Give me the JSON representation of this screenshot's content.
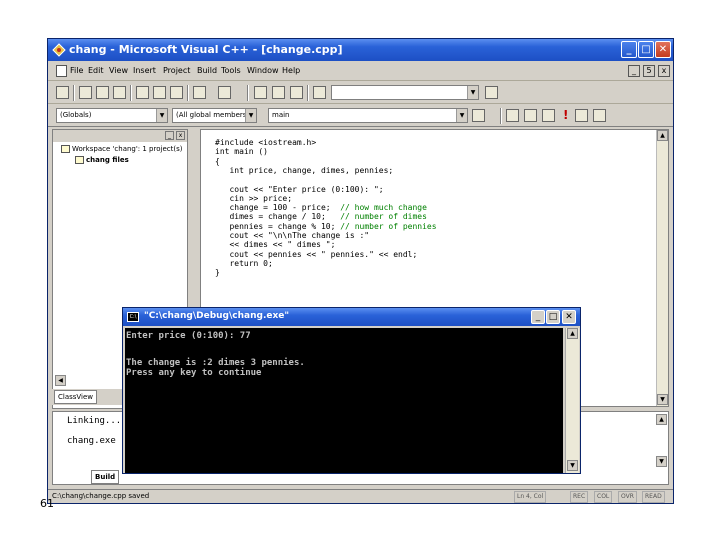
{
  "page_number": "61",
  "ide": {
    "title": "chang - Microsoft Visual C++ - [change.cpp]",
    "menu": [
      "File",
      "Edit",
      "View",
      "Insert",
      "Project",
      "Build",
      "Tools",
      "Window",
      "Help"
    ],
    "mdi_controls": [
      "_",
      "5",
      "x"
    ],
    "caption_controls": [
      "_",
      "□",
      "✕"
    ],
    "toolbar2": {
      "class_combo": "(Globals)",
      "members_combo": "(All global members)",
      "function_combo": "main"
    }
  },
  "workspace": {
    "header_buttons": [
      "x"
    ],
    "tree": [
      "Workspace 'chang': 1 project(s)",
      "chang files"
    ],
    "tabs": [
      "ClassView"
    ]
  },
  "editor": {
    "lines": [
      {
        "text": "#include <iostream.h>",
        "kind": "normal"
      },
      {
        "text": "int main ()",
        "kind": "normal"
      },
      {
        "text": "{",
        "kind": "normal"
      },
      {
        "text": "   int price, change, dimes, pennies;",
        "kind": "normal"
      },
      {
        "text": "",
        "kind": "normal"
      },
      {
        "text": "   cout << \"Enter price (0:100): \";",
        "kind": "normal"
      },
      {
        "text": "   cin >> price;",
        "kind": "normal"
      },
      {
        "text": "   change = 100 - price;",
        "code": "   change = 100 - price;",
        "comment": "  // how much change",
        "kind": "comment"
      },
      {
        "text": "   dimes = change / 10;",
        "code": "   dimes = change / 10;",
        "comment": "   // number of dimes",
        "kind": "comment"
      },
      {
        "text": "   pennies = change % 10;",
        "code": "   pennies = change % 10;",
        "comment": " // number of pennies",
        "kind": "comment"
      },
      {
        "text": "   cout << \"\\n\\nThe change is :\"",
        "kind": "normal"
      },
      {
        "text": "   << dimes << \" dimes \";",
        "kind": "normal"
      },
      {
        "text": "   cout << pennies << \" pennies.\" << endl;",
        "kind": "normal"
      },
      {
        "text": "   return 0;",
        "kind": "normal"
      },
      {
        "text": "}",
        "kind": "normal"
      }
    ]
  },
  "output": {
    "lines": [
      "Linking...",
      "",
      "chang.exe"
    ],
    "tab": "Build"
  },
  "statusbar": {
    "text": "C:\\chang\\change.cpp saved",
    "position": "Ln 4, Col",
    "indicators": [
      "REC",
      "COL",
      "OVR",
      "READ"
    ]
  },
  "console": {
    "title": "\"C:\\chang\\Debug\\chang.exe\"",
    "controls": [
      "_",
      "□",
      "✕"
    ],
    "lines": [
      "Enter price (0:100): 77",
      "",
      "The change is :2 dimes 3 pennies.",
      "Press any key to continue"
    ]
  }
}
